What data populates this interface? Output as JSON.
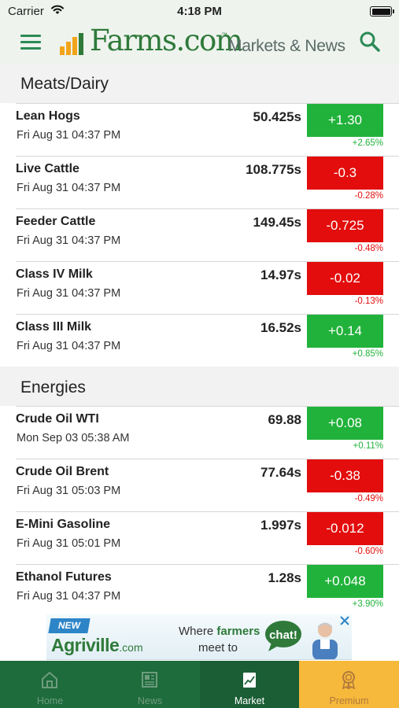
{
  "status_bar": {
    "carrier": "Carrier",
    "time": "4:18 PM"
  },
  "header": {
    "logo_text": "Farms.com",
    "logo_trademark": "™",
    "subtitle": "Markets & News",
    "accent_color": "#2f7a3a"
  },
  "sections": [
    {
      "title": "Meats/Dairy",
      "rows": [
        {
          "name": "Lean Hogs",
          "date": "Fri Aug 31 04:37 PM",
          "price": "50.425s",
          "change": "+1.30",
          "pct": "+2.65%",
          "direction": "up"
        },
        {
          "name": "Live Cattle",
          "date": "Fri Aug 31 04:37 PM",
          "price": "108.775s",
          "change": "-0.3",
          "pct": "-0.28%",
          "direction": "down"
        },
        {
          "name": "Feeder Cattle",
          "date": "Fri Aug 31 04:37 PM",
          "price": "149.45s",
          "change": "-0.725",
          "pct": "-0.48%",
          "direction": "down"
        },
        {
          "name": "Class IV Milk",
          "date": "Fri Aug 31 04:37 PM",
          "price": "14.97s",
          "change": "-0.02",
          "pct": "-0.13%",
          "direction": "down"
        },
        {
          "name": "Class III Milk",
          "date": "Fri Aug 31 04:37 PM",
          "price": "16.52s",
          "change": "+0.14",
          "pct": "+0.85%",
          "direction": "up"
        }
      ]
    },
    {
      "title": "Energies",
      "rows": [
        {
          "name": "Crude Oil WTI",
          "date": "Mon Sep 03 05:38 AM",
          "price": "69.88",
          "change": "+0.08",
          "pct": "+0.11%",
          "direction": "up"
        },
        {
          "name": "Crude Oil Brent",
          "date": "Fri Aug 31 05:03 PM",
          "price": "77.64s",
          "change": "-0.38",
          "pct": "-0.49%",
          "direction": "down"
        },
        {
          "name": "E-Mini Gasoline",
          "date": "Fri Aug 31 05:01 PM",
          "price": "1.997s",
          "change": "-0.012",
          "pct": "-0.60%",
          "direction": "down"
        },
        {
          "name": "Ethanol Futures",
          "date": "Fri Aug 31 04:37 PM",
          "price": "1.28s",
          "change": "+0.048",
          "pct": "+3.90%",
          "direction": "up"
        }
      ]
    }
  ],
  "ad": {
    "badge": "NEW",
    "brand": "Agriville",
    "brand_suffix": ".com",
    "line1_prefix": "Where ",
    "line1_highlight": "farmers",
    "line2": "meet to",
    "bubble": "chat!"
  },
  "tabs": [
    {
      "label": "Home",
      "icon": "home-icon",
      "state": "inactive"
    },
    {
      "label": "News",
      "icon": "newspaper-icon",
      "state": "inactive"
    },
    {
      "label": "Market",
      "icon": "chart-icon",
      "state": "active"
    },
    {
      "label": "Premium",
      "icon": "award-icon",
      "state": "premium"
    }
  ],
  "colors": {
    "up": "#21b23b",
    "down": "#e30d0d",
    "tab_bar": "#1e6b3c",
    "premium": "#f6b93b"
  }
}
